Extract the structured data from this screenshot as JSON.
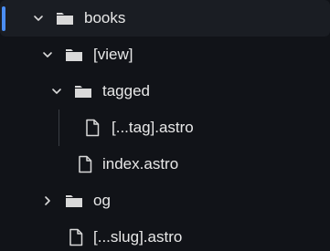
{
  "tree": {
    "items": [
      {
        "label": "books",
        "type": "folder",
        "expanded": true,
        "icon": "folder-icon",
        "chevron": "chevron-down-icon"
      },
      {
        "label": "[view]",
        "type": "folder",
        "expanded": true,
        "icon": "folder-icon",
        "chevron": "chevron-down-icon"
      },
      {
        "label": "tagged",
        "type": "folder",
        "expanded": true,
        "icon": "folder-icon",
        "chevron": "chevron-down-icon"
      },
      {
        "label": "[...tag].astro",
        "type": "file",
        "icon": "file-icon"
      },
      {
        "label": "index.astro",
        "type": "file",
        "icon": "file-icon"
      },
      {
        "label": "og",
        "type": "folder",
        "expanded": false,
        "icon": "folder-icon",
        "chevron": "chevron-right-icon"
      },
      {
        "label": "[...slug].astro",
        "type": "file",
        "icon": "file-icon"
      }
    ]
  },
  "colors": {
    "background": "#111318",
    "selected_row": "#1a1d23",
    "accent": "#4b8ef4",
    "icon": "#d9d9d9",
    "text": "#e8e8e8",
    "guide": "#3a3d44"
  }
}
